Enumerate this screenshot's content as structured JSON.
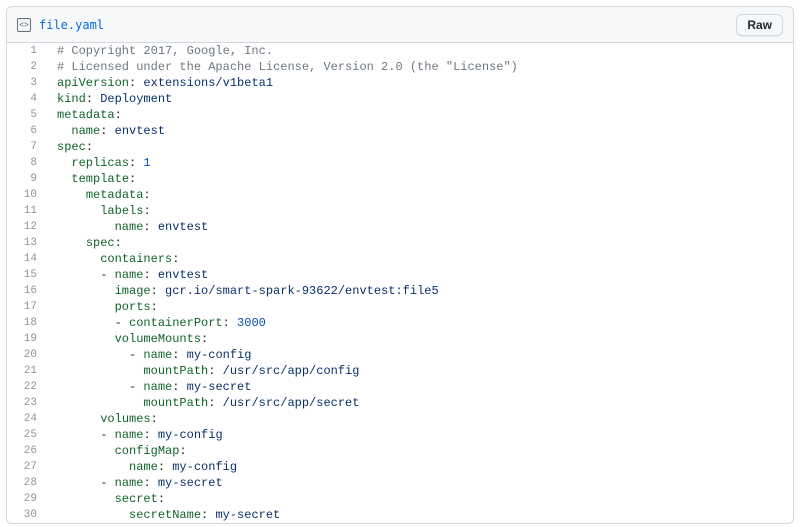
{
  "header": {
    "filename": "file.yaml",
    "raw_label": "Raw",
    "icon_glyph": "<>"
  },
  "code": {
    "lines": [
      {
        "n": 1,
        "i": 0,
        "t": [
          [
            "cm",
            "# Copyright 2017, Google, Inc."
          ]
        ]
      },
      {
        "n": 2,
        "i": 0,
        "t": [
          [
            "cm",
            "# Licensed under the Apache License, Version 2.0 (the \"License\")"
          ]
        ]
      },
      {
        "n": 3,
        "i": 0,
        "t": [
          [
            "k",
            "apiVersion"
          ],
          [
            "p",
            ": "
          ],
          [
            "s",
            "extensions/v1beta1"
          ]
        ]
      },
      {
        "n": 4,
        "i": 0,
        "t": [
          [
            "k",
            "kind"
          ],
          [
            "p",
            ": "
          ],
          [
            "s",
            "Deployment"
          ]
        ]
      },
      {
        "n": 5,
        "i": 0,
        "t": [
          [
            "k",
            "metadata"
          ],
          [
            "p",
            ":"
          ]
        ]
      },
      {
        "n": 6,
        "i": 1,
        "t": [
          [
            "k",
            "name"
          ],
          [
            "p",
            ": "
          ],
          [
            "s",
            "envtest"
          ]
        ]
      },
      {
        "n": 7,
        "i": 0,
        "t": [
          [
            "k",
            "spec"
          ],
          [
            "p",
            ":"
          ]
        ]
      },
      {
        "n": 8,
        "i": 1,
        "t": [
          [
            "k",
            "replicas"
          ],
          [
            "p",
            ": "
          ],
          [
            "n",
            "1"
          ]
        ]
      },
      {
        "n": 9,
        "i": 1,
        "t": [
          [
            "k",
            "template"
          ],
          [
            "p",
            ":"
          ]
        ]
      },
      {
        "n": 10,
        "i": 2,
        "t": [
          [
            "k",
            "metadata"
          ],
          [
            "p",
            ":"
          ]
        ]
      },
      {
        "n": 11,
        "i": 3,
        "t": [
          [
            "k",
            "labels"
          ],
          [
            "p",
            ":"
          ]
        ]
      },
      {
        "n": 12,
        "i": 4,
        "t": [
          [
            "k",
            "name"
          ],
          [
            "p",
            ": "
          ],
          [
            "s",
            "envtest"
          ]
        ]
      },
      {
        "n": 13,
        "i": 2,
        "t": [
          [
            "k",
            "spec"
          ],
          [
            "p",
            ":"
          ]
        ]
      },
      {
        "n": 14,
        "i": 3,
        "t": [
          [
            "k",
            "containers"
          ],
          [
            "p",
            ":"
          ]
        ]
      },
      {
        "n": 15,
        "i": 3,
        "t": [
          [
            "p",
            "- "
          ],
          [
            "k",
            "name"
          ],
          [
            "p",
            ": "
          ],
          [
            "s",
            "envtest"
          ]
        ]
      },
      {
        "n": 16,
        "i": 4,
        "t": [
          [
            "k",
            "image"
          ],
          [
            "p",
            ": "
          ],
          [
            "s",
            "gcr.io/smart-spark-93622/envtest:file5"
          ]
        ]
      },
      {
        "n": 17,
        "i": 4,
        "t": [
          [
            "k",
            "ports"
          ],
          [
            "p",
            ":"
          ]
        ]
      },
      {
        "n": 18,
        "i": 4,
        "t": [
          [
            "p",
            "- "
          ],
          [
            "k",
            "containerPort"
          ],
          [
            "p",
            ": "
          ],
          [
            "n",
            "3000"
          ]
        ]
      },
      {
        "n": 19,
        "i": 4,
        "t": [
          [
            "k",
            "volumeMounts"
          ],
          [
            "p",
            ":"
          ]
        ]
      },
      {
        "n": 20,
        "i": 5,
        "t": [
          [
            "p",
            "- "
          ],
          [
            "k",
            "name"
          ],
          [
            "p",
            ": "
          ],
          [
            "s",
            "my-config"
          ]
        ]
      },
      {
        "n": 21,
        "i": 6,
        "t": [
          [
            "k",
            "mountPath"
          ],
          [
            "p",
            ": "
          ],
          [
            "s",
            "/usr/src/app/config"
          ]
        ]
      },
      {
        "n": 22,
        "i": 5,
        "t": [
          [
            "p",
            "- "
          ],
          [
            "k",
            "name"
          ],
          [
            "p",
            ": "
          ],
          [
            "s",
            "my-secret"
          ]
        ]
      },
      {
        "n": 23,
        "i": 6,
        "t": [
          [
            "k",
            "mountPath"
          ],
          [
            "p",
            ": "
          ],
          [
            "s",
            "/usr/src/app/secret"
          ]
        ]
      },
      {
        "n": 24,
        "i": 3,
        "t": [
          [
            "k",
            "volumes"
          ],
          [
            "p",
            ":"
          ]
        ]
      },
      {
        "n": 25,
        "i": 3,
        "t": [
          [
            "p",
            "- "
          ],
          [
            "k",
            "name"
          ],
          [
            "p",
            ": "
          ],
          [
            "s",
            "my-config"
          ]
        ]
      },
      {
        "n": 26,
        "i": 4,
        "t": [
          [
            "k",
            "configMap"
          ],
          [
            "p",
            ":"
          ]
        ]
      },
      {
        "n": 27,
        "i": 5,
        "t": [
          [
            "k",
            "name"
          ],
          [
            "p",
            ": "
          ],
          [
            "s",
            "my-config"
          ]
        ]
      },
      {
        "n": 28,
        "i": 3,
        "t": [
          [
            "p",
            "- "
          ],
          [
            "k",
            "name"
          ],
          [
            "p",
            ": "
          ],
          [
            "s",
            "my-secret"
          ]
        ]
      },
      {
        "n": 29,
        "i": 4,
        "t": [
          [
            "k",
            "secret"
          ],
          [
            "p",
            ":"
          ]
        ]
      },
      {
        "n": 30,
        "i": 5,
        "t": [
          [
            "k",
            "secretName"
          ],
          [
            "p",
            ": "
          ],
          [
            "s",
            "my-secret"
          ]
        ]
      }
    ]
  }
}
